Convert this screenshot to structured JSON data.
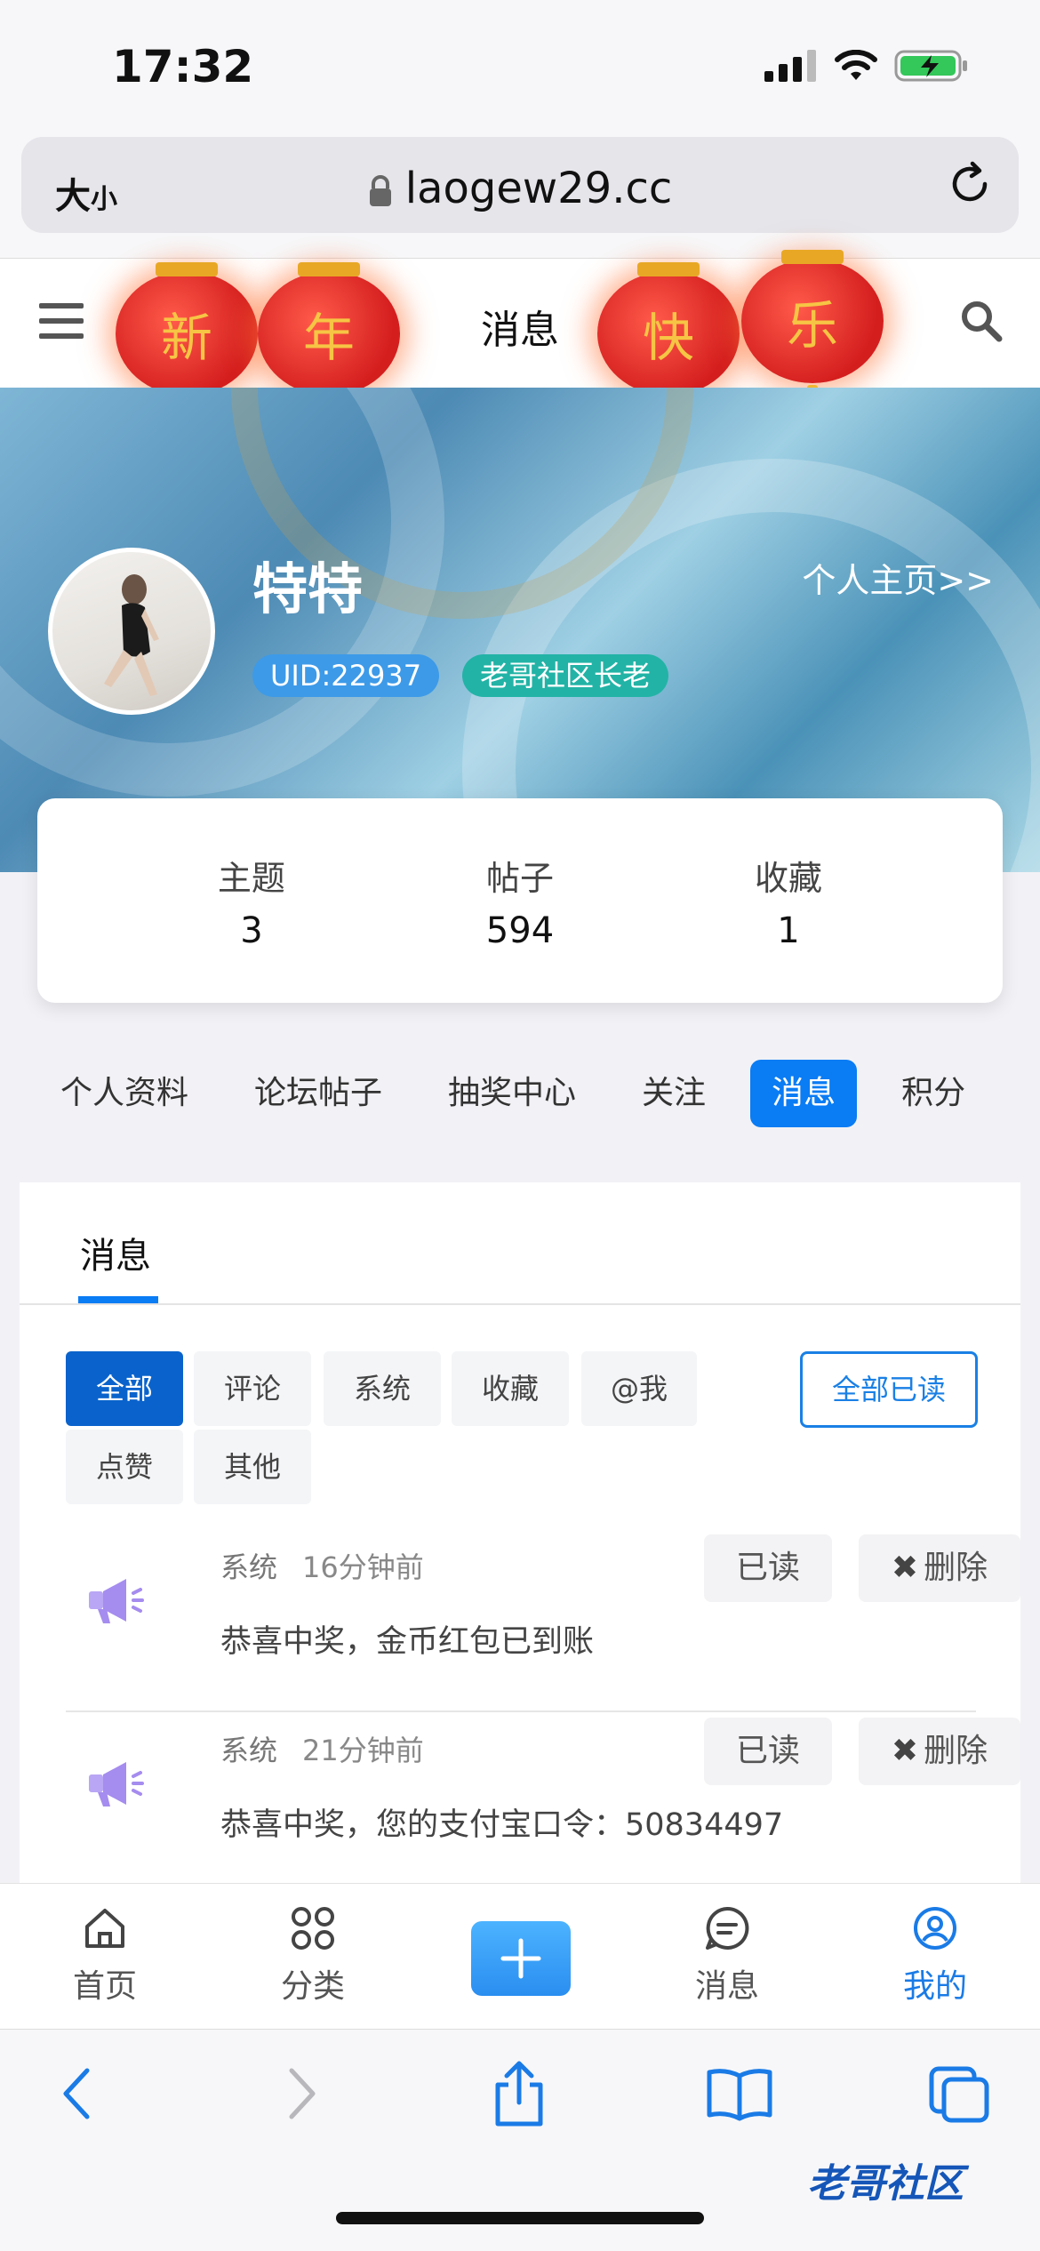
{
  "status": {
    "time": "17:32"
  },
  "browser": {
    "text_size_label": "大",
    "text_size_small": "小",
    "url": "laogew29.cc"
  },
  "header": {
    "title": "消息",
    "lanterns": [
      "新",
      "年",
      "快",
      "乐"
    ]
  },
  "profile": {
    "username": "特特",
    "homepage_link": "个人主页>>",
    "uid": "UID:22937",
    "rank": "老哥社区长老"
  },
  "stats": [
    {
      "label": "主题",
      "value": "3"
    },
    {
      "label": "帖子",
      "value": "594"
    },
    {
      "label": "收藏",
      "value": "1"
    }
  ],
  "profile_tabs": [
    "个人资料",
    "论坛帖子",
    "抽奖中心",
    "关注",
    "消息",
    "积分"
  ],
  "messages_panel": {
    "title": "消息",
    "filters": [
      "全部",
      "评论",
      "系统",
      "收藏",
      "@我",
      "点赞",
      "其他"
    ],
    "mark_all_read": "全部已读",
    "items": [
      {
        "type": "系统",
        "time": "16分钟前",
        "text": "恭喜中奖，金币红包已到账",
        "read_label": "已读",
        "delete_label": "删除"
      },
      {
        "type": "系统",
        "time": "21分钟前",
        "text": "恭喜中奖，您的支付宝口令：50834497",
        "read_label": "已读",
        "delete_label": "删除"
      }
    ]
  },
  "bottom_nav": {
    "home": "首页",
    "category": "分类",
    "messages": "消息",
    "mine": "我的"
  },
  "watermark": "老哥社区",
  "colors": {
    "accent": "#0a7cf4",
    "active_filter": "#0a63cc",
    "uid_badge": "#3d9ae8",
    "rank_badge": "#22b3a6",
    "lantern": "#d41e1e"
  }
}
